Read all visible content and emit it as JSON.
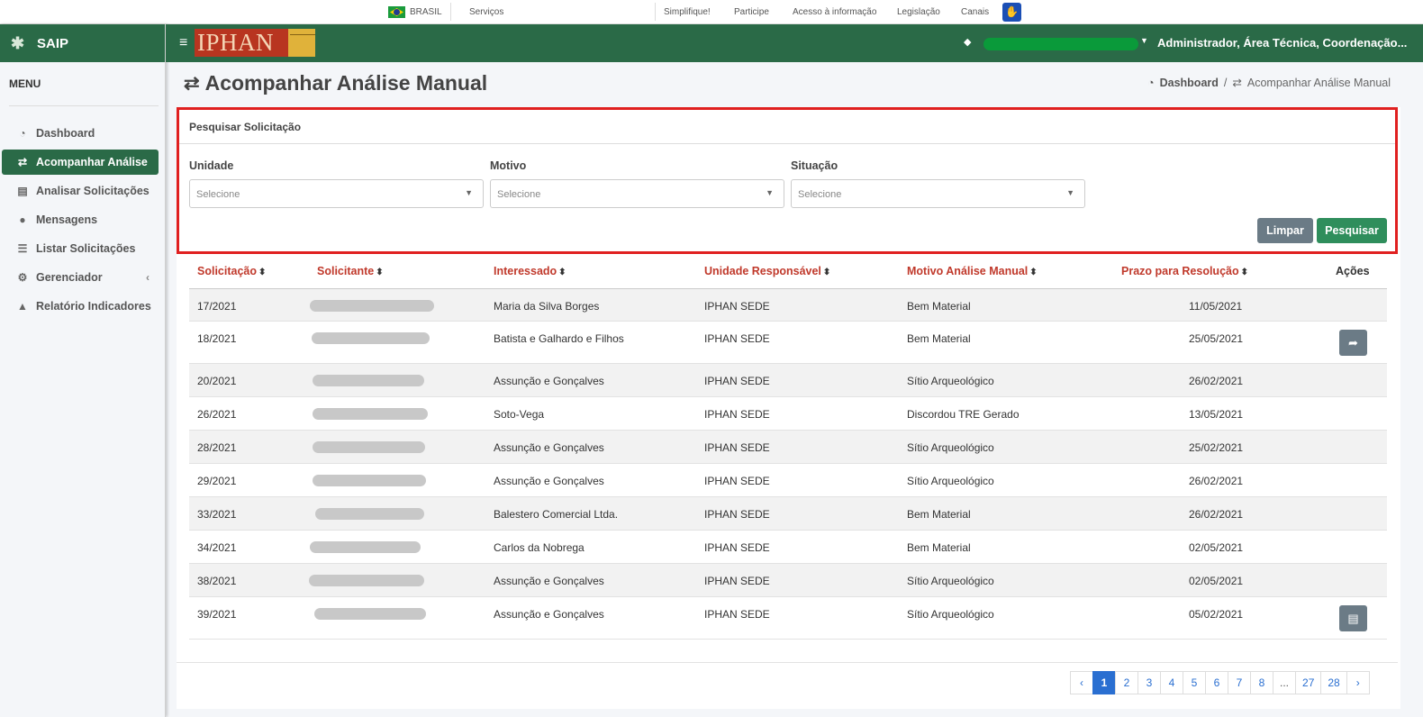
{
  "govbar": {
    "brasil": "BRASIL",
    "servicos": "Serviços",
    "links": [
      "Simplifique!",
      "Participe",
      "Acesso à informação",
      "Legislação",
      "Canais"
    ]
  },
  "sidebar": {
    "app_name": "SAIP",
    "menu_title": "MENU",
    "items": [
      {
        "label": "Dashboard",
        "icon": "dashboard-icon"
      },
      {
        "label": "Acompanhar Análise",
        "icon": "exchange-icon",
        "active": true
      },
      {
        "label": "Analisar Solicitações",
        "icon": "book-icon"
      },
      {
        "label": "Mensagens",
        "icon": "comments-icon"
      },
      {
        "label": "Listar Solicitações",
        "icon": "list-icon"
      },
      {
        "label": "Gerenciador",
        "icon": "cogs-icon",
        "has_submenu": true
      },
      {
        "label": "Relatório Indicadores",
        "icon": "area-chart-icon"
      }
    ]
  },
  "header": {
    "logo_text": "IPHAN",
    "user_role": "Administrador, Área Técnica, Coordenação..."
  },
  "page": {
    "title": "Acompanhar Análise Manual",
    "breadcrumb": {
      "home": "Dashboard",
      "current": "Acompanhar Análise Manual"
    }
  },
  "search": {
    "title": "Pesquisar Solicitação",
    "fields": [
      {
        "label": "Unidade",
        "value": "Selecione"
      },
      {
        "label": "Motivo",
        "value": "Selecione"
      },
      {
        "label": "Situação",
        "value": "Selecione"
      }
    ],
    "clear_label": "Limpar",
    "search_label": "Pesquisar"
  },
  "table": {
    "columns": [
      "Solicitação",
      "Solicitante",
      "Interessado",
      "Unidade Responsável",
      "Motivo Análise Manual",
      "Prazo para Resolução",
      "Ações"
    ],
    "rows": [
      {
        "id": "17/2021",
        "interessado": "Maria da Silva Borges",
        "unidade": "IPHAN SEDE",
        "motivo": "Bem Material",
        "prazo": "11/05/2021",
        "action": ""
      },
      {
        "id": "18/2021",
        "interessado": "Batista e Galhardo e Filhos",
        "unidade": "IPHAN SEDE",
        "motivo": "Bem Material",
        "prazo": "25/05/2021",
        "action": "forward-icon"
      },
      {
        "id": "20/2021",
        "interessado": "Assunção e Gonçalves",
        "unidade": "IPHAN SEDE",
        "motivo": "Sítio Arqueológico",
        "prazo": "26/02/2021",
        "action": ""
      },
      {
        "id": "26/2021",
        "interessado": "Soto-Vega",
        "unidade": "IPHAN SEDE",
        "motivo": "Discordou TRE Gerado",
        "prazo": "13/05/2021",
        "action": ""
      },
      {
        "id": "28/2021",
        "interessado": "Assunção e Gonçalves",
        "unidade": "IPHAN SEDE",
        "motivo": "Sítio Arqueológico",
        "prazo": "25/02/2021",
        "action": ""
      },
      {
        "id": "29/2021",
        "interessado": "Assunção e Gonçalves",
        "unidade": "IPHAN SEDE",
        "motivo": "Sítio Arqueológico",
        "prazo": "26/02/2021",
        "action": ""
      },
      {
        "id": "33/2021",
        "interessado": "Balestero Comercial Ltda.",
        "unidade": "IPHAN SEDE",
        "motivo": "Bem Material",
        "prazo": "26/02/2021",
        "action": ""
      },
      {
        "id": "34/2021",
        "interessado": "Carlos da Nobrega",
        "unidade": "IPHAN SEDE",
        "motivo": "Bem Material",
        "prazo": "02/05/2021",
        "action": ""
      },
      {
        "id": "38/2021",
        "interessado": "Assunção e Gonçalves",
        "unidade": "IPHAN SEDE",
        "motivo": "Sítio Arqueológico",
        "prazo": "02/05/2021",
        "action": ""
      },
      {
        "id": "39/2021",
        "interessado": "Assunção e Gonçalves",
        "unidade": "IPHAN SEDE",
        "motivo": "Sítio Arqueológico",
        "prazo": "05/02/2021",
        "action": "document-icon"
      }
    ]
  },
  "pagination": {
    "prev": "‹",
    "pages": [
      "1",
      "2",
      "3",
      "4",
      "5",
      "6",
      "7",
      "8",
      "...",
      "27",
      "28"
    ],
    "current": "1",
    "next": "›"
  },
  "colors": {
    "brand_green": "#2a6a47",
    "highlight_red": "#e02020",
    "header_link_red": "#c0392b",
    "pager_blue": "#2a6fd1"
  }
}
